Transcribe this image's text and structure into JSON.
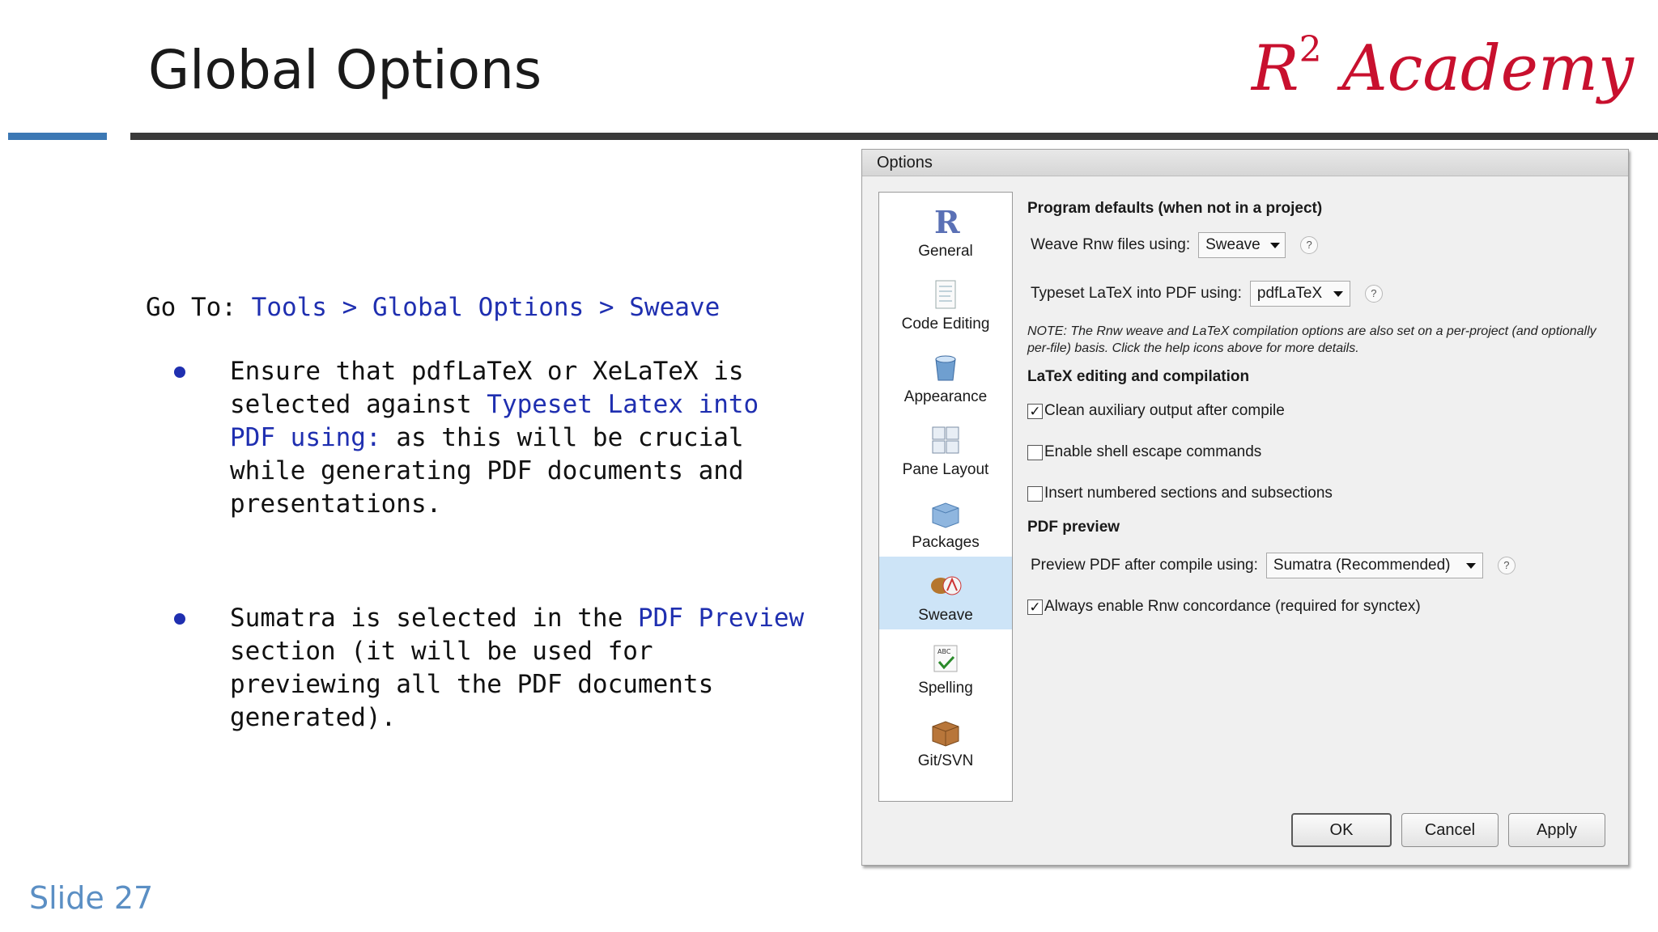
{
  "slide": {
    "title": "Global Options",
    "brand": "R",
    "brand_sup": "2",
    "brand_rest": " Academy",
    "number": "Slide 27"
  },
  "left": {
    "goto_prefix": "Go To: ",
    "goto_path": "Tools > Global Options > Sweave",
    "bullet1_a": "Ensure that pdfLaTeX or XeLaTeX is selected against ",
    "bullet1_hl": "Typeset Latex into PDF using:",
    "bullet1_b": " as this will be crucial while generating PDF documents and presentations.",
    "bullet2_a": "Sumatra is selected in the ",
    "bullet2_hl": "PDF Preview",
    "bullet2_b": " section (it will be used for previewing all the PDF documents generated)."
  },
  "dialog": {
    "title": "Options",
    "sidebar": [
      {
        "label": "General",
        "icon": "r-logo-icon"
      },
      {
        "label": "Code Editing",
        "icon": "document-icon"
      },
      {
        "label": "Appearance",
        "icon": "paint-bucket-icon"
      },
      {
        "label": "Pane Layout",
        "icon": "grid-icon"
      },
      {
        "label": "Packages",
        "icon": "package-icon"
      },
      {
        "label": "Sweave",
        "icon": "sweave-pdf-icon"
      },
      {
        "label": "Spelling",
        "icon": "spellcheck-icon"
      },
      {
        "label": "Git/SVN",
        "icon": "box-icon"
      }
    ],
    "active_item": "Sweave",
    "program_defaults_heading": "Program defaults (when not in a project)",
    "weave_label": "Weave Rnw files using:",
    "weave_value": "Sweave",
    "typeset_label": "Typeset LaTeX into PDF using:",
    "typeset_value": "pdfLaTeX",
    "help_symbol": "?",
    "note": "NOTE: The Rnw weave and LaTeX compilation options are also set on a per-project (and optionally per-file) basis. Click the help icons above for more details.",
    "latex_heading": "LaTeX editing and compilation",
    "opt_clean": "Clean auxiliary output after compile",
    "opt_shell": "Enable shell escape commands",
    "opt_numbered": "Insert numbered sections and subsections",
    "pdf_heading": "PDF preview",
    "preview_label": "Preview PDF after compile using:",
    "preview_value": "Sumatra (Recommended)",
    "opt_concordance": "Always enable Rnw concordance (required for synctex)",
    "ok": "OK",
    "cancel": "Cancel",
    "apply": "Apply",
    "check_mark": "✓"
  }
}
